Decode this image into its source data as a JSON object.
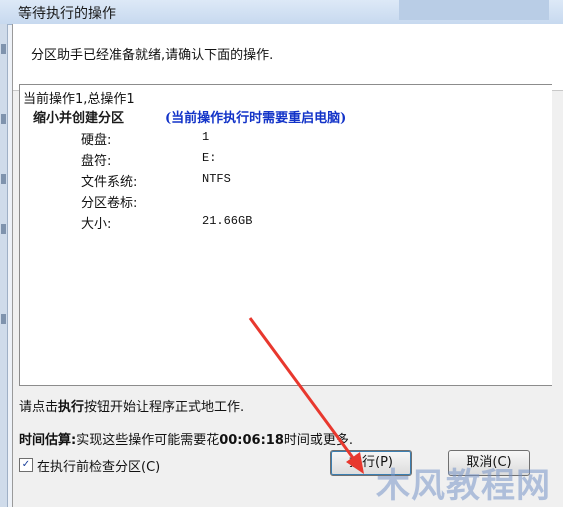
{
  "window": {
    "title": "等待执行的操作"
  },
  "header": {
    "ready_text": "分区助手已经准备就绪,请确认下面的操作."
  },
  "details": {
    "counter": "当前操作1,总操作1",
    "operation_title": "缩小并创建分区",
    "reboot_note": "(当前操作执行时需要重启电脑)",
    "fields": [
      {
        "label": "硬盘:",
        "value": "1"
      },
      {
        "label": "盘符:",
        "value": "E:"
      },
      {
        "label": "文件系统:",
        "value": "NTFS"
      },
      {
        "label": "分区卷标:",
        "value": ""
      },
      {
        "label": "大小:",
        "value": "21.66GB"
      }
    ]
  },
  "hint": {
    "prefix": "请点击",
    "bold_word": "执行",
    "suffix": "按钮开始让程序正式地工作."
  },
  "estimate": {
    "label": "时间估算:",
    "prefix": "实现这些操作可能需要花",
    "time": "00:06:18",
    "suffix": "时间或更多."
  },
  "check_partition": {
    "label": "在执行前检查分区(C)",
    "checked": true,
    "mark": "✓"
  },
  "buttons": {
    "execute": "执行(P)",
    "cancel": "取消(C)"
  },
  "watermark": "木风教程网",
  "colors": {
    "accent_blue": "#1233c8",
    "arrow_red": "#e8382e"
  }
}
